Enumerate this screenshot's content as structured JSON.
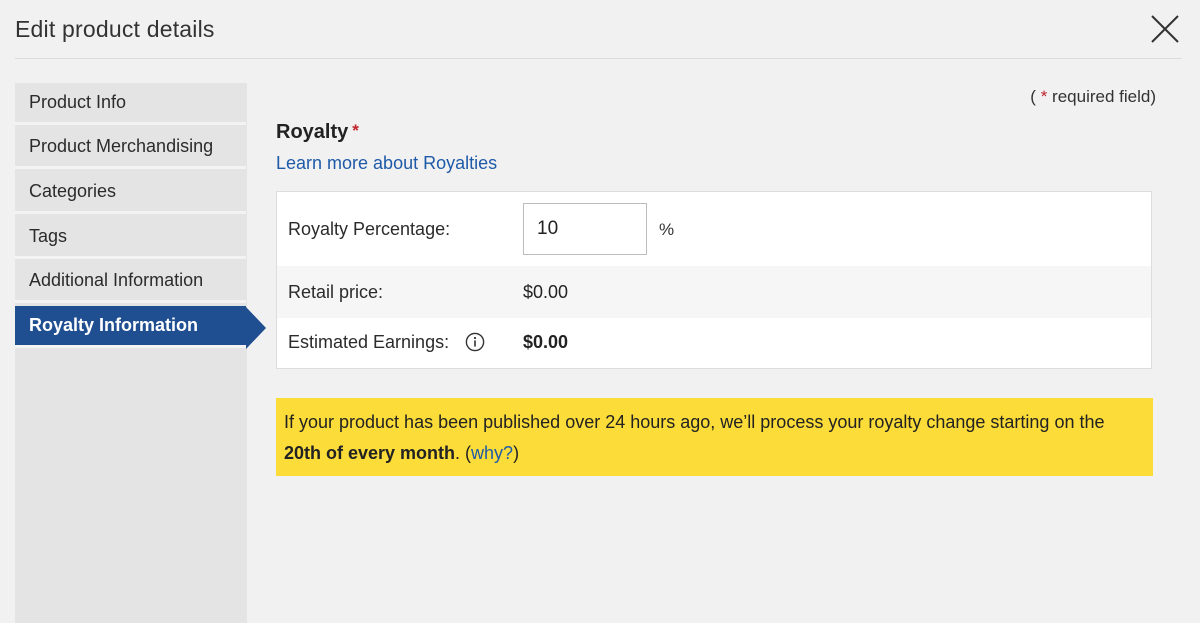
{
  "dialog": {
    "title": "Edit product details",
    "close_icon": "close-icon"
  },
  "sidebar": {
    "items": [
      {
        "label": "Product Info",
        "active": false
      },
      {
        "label": "Product Merchandising",
        "active": false
      },
      {
        "label": "Categories",
        "active": false
      },
      {
        "label": "Tags",
        "active": false
      },
      {
        "label": "Additional Information",
        "active": false
      },
      {
        "label": "Royalty Information",
        "active": true
      }
    ]
  },
  "required_note": {
    "open": "(",
    "star": "*",
    "text": "required field)"
  },
  "royalty": {
    "title": "Royalty",
    "required_star": "*",
    "learn_more": "Learn more about Royalties",
    "percentage_label": "Royalty Percentage:",
    "percentage_value": "10",
    "percent_sign": "%",
    "retail_label": "Retail price:",
    "retail_value": "$0.00",
    "earnings_label": "Estimated Earnings:",
    "earnings_value": "$0.00",
    "info_icon": "info-icon"
  },
  "notice": {
    "text_before": "If your product has been published over 24 hours ago, we’ll process your royalty change starting on the ",
    "bold_text": "20th of every month",
    "text_after": ". (",
    "why_link": "why?",
    "close_paren": ")"
  },
  "colors": {
    "accent": "#1f4e91",
    "link": "#1e5aa8",
    "required": "#c0212b",
    "notice_bg": "#fcdc38"
  }
}
